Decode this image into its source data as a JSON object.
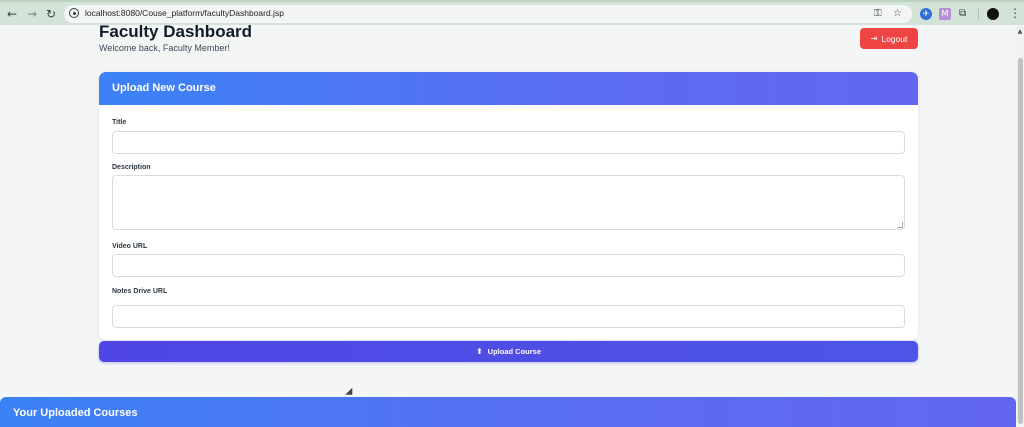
{
  "browser": {
    "url": "localhost:8080/Couse_platform/facultyDashboard.jsp",
    "back_glyph": "←",
    "forward_glyph": "→",
    "reload_glyph": "↻",
    "key_glyph": "⚿",
    "star_glyph": "☆",
    "extensions_glyph": "⧉",
    "menu_glyph": "⋮",
    "ext_blue_glyph": "✈",
    "ext_purple_glyph": "M"
  },
  "header": {
    "title": "Faculty Dashboard",
    "subtitle": "Welcome back, Faculty Member!",
    "logout_label": "Logout",
    "logout_icon": "⇥"
  },
  "upload_card": {
    "title": "Upload New Course",
    "fields": [
      {
        "label": "Title",
        "value": ""
      },
      {
        "label": "Description",
        "value": ""
      },
      {
        "label": "Video URL",
        "value": ""
      },
      {
        "label": "Notes Drive URL",
        "value": ""
      }
    ],
    "submit_label": "Upload Course",
    "submit_icon": "⬆"
  },
  "courses_section": {
    "title": "Your Uploaded Courses"
  },
  "colors": {
    "accent_gradient_start": "#3b82f6",
    "accent_gradient_end": "#6366f1",
    "logout": "#ef4444",
    "upload_button": "#4f46e5"
  }
}
